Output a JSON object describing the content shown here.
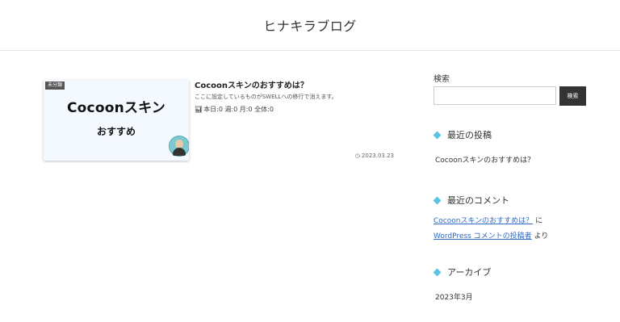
{
  "site": {
    "title": "ヒナキラブログ"
  },
  "entry": {
    "category": "未分類",
    "thumbnail_title": "Cocoonスキン",
    "thumbnail_subtitle": "おすすめ",
    "title": "Cocoonスキンのおすすめは？",
    "snippet": "ここに設定しているものがSWELLへの移行で消えます。",
    "stats_icon": "bar-chart-icon",
    "stats": "本日:0 週:0 月:0 全体:0",
    "date_icon": "clock-icon",
    "date": "2023.03.23"
  },
  "sidebar": {
    "search": {
      "label": "検索",
      "button_label": "検索",
      "value": ""
    },
    "recent_posts": {
      "heading": "最近の投稿",
      "items": [
        "Cocoonスキンのおすすめは？"
      ]
    },
    "recent_comments": {
      "heading": "最近のコメント",
      "items": [
        {
          "post": "Cocoonスキンのおすすめは？",
          "connector": "に"
        },
        {
          "author": "WordPress コメントの投稿者",
          "connector": "より"
        }
      ]
    },
    "archive": {
      "heading": "アーカイブ",
      "items": [
        "2023年3月"
      ]
    }
  },
  "colors": {
    "accent": "#5bc4e6",
    "link": "#2f6bc4",
    "button": "#333333"
  }
}
